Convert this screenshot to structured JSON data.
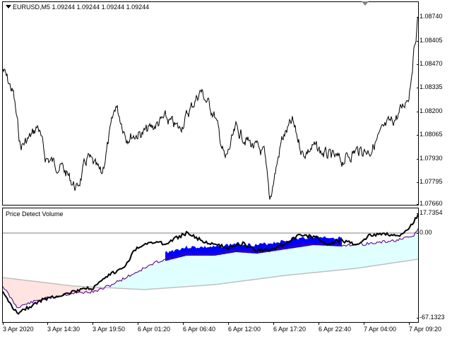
{
  "main_chart": {
    "symbol_line": "EURUSD,M5  1.09244 1.09244 1.09244 1.09244",
    "price_ticks": [
      "1.08740",
      "1.08405",
      "1.08470",
      "1.08335",
      "1.08200",
      "1.08065",
      "1.07930",
      "1.07795",
      "1.07660"
    ],
    "colors": {
      "price_line": "#000000",
      "background": "#ffffff"
    }
  },
  "indicator": {
    "title": "Price Detect Volume",
    "ticks": {
      "top": "17.7354",
      "zero": "0.00",
      "bottom": "-67.1323"
    },
    "colors": {
      "black_line": "#000000",
      "blue_band": "#0000ff",
      "red_line": "#c00000",
      "cyan_fill": "#e0ffff",
      "pink_fill": "#ffe4e1",
      "gray_line": "#c0c0c0"
    }
  },
  "time_axis": {
    "ticks": [
      "3 Apr 2020",
      "3 Apr 14:30",
      "3 Apr 19:50",
      "6 Apr 01:20",
      "6 Apr 06:40",
      "6 Apr 12:00",
      "6 Apr 17:20",
      "6 Apr 22:40",
      "7 Apr 04:00",
      "7 Apr 09:20"
    ]
  }
}
